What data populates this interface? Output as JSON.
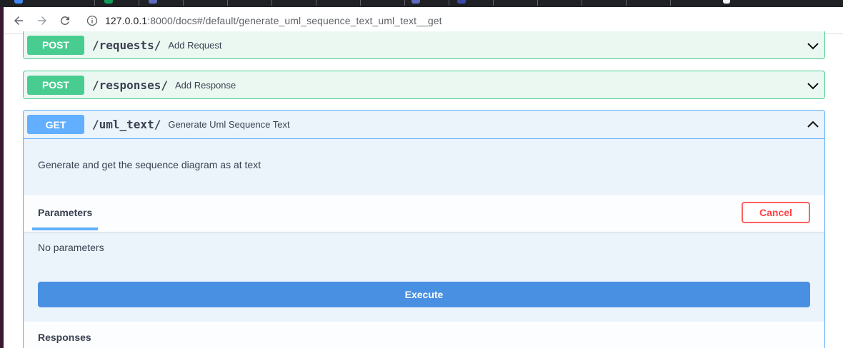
{
  "browser": {
    "url_host": "127.0.0.1",
    "url_path": ":8000/docs#/default/generate_uml_sequence_text_uml_text__get"
  },
  "operations": [
    {
      "method": "POST",
      "path": "/requests/",
      "summary": "Add Request",
      "expanded": false,
      "color": "#49cc90"
    },
    {
      "method": "POST",
      "path": "/responses/",
      "summary": "Add Response",
      "expanded": false,
      "color": "#49cc90"
    },
    {
      "method": "GET",
      "path": "/uml_text/",
      "summary": "Generate Uml Sequence Text",
      "expanded": true,
      "color": "#61affe"
    }
  ],
  "expanded_op": {
    "description": "Generate and get the sequence diagram as at text",
    "parameters_title": "Parameters",
    "cancel_label": "Cancel",
    "no_parameters": "No parameters",
    "execute_label": "Execute",
    "responses_title": "Responses"
  },
  "icons": {
    "back": "arrow-left-icon",
    "forward": "arrow-right-icon",
    "reload": "reload-icon",
    "info": "info-icon",
    "collapse": "chevron-down-icon",
    "expand": "chevron-up-icon"
  },
  "colors": {
    "post": "#49cc90",
    "get": "#61affe",
    "execute": "#4990e2",
    "cancel": "#ff6060"
  }
}
